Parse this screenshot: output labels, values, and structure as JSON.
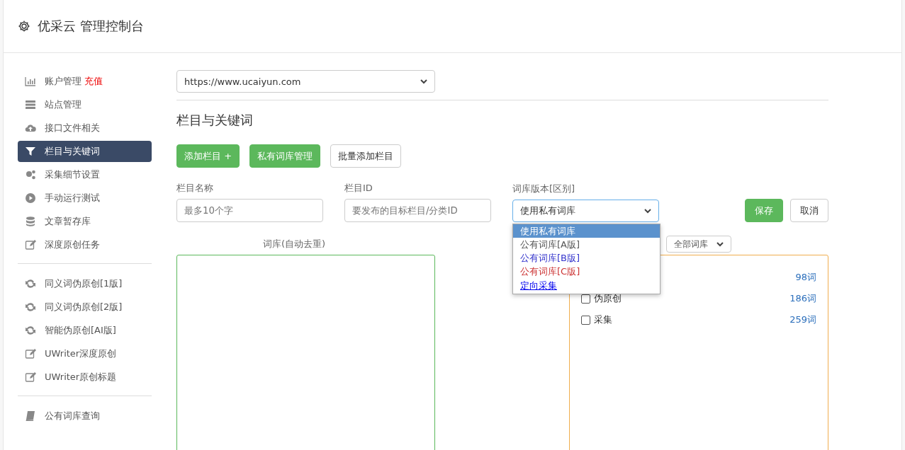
{
  "header": {
    "title": "优采云 管理控制台"
  },
  "sidebar": {
    "groups": [
      {
        "items": [
          {
            "label": "账户管理",
            "badge": "充值",
            "selected": false
          },
          {
            "label": "站点管理",
            "selected": false
          },
          {
            "label": "接口文件相关",
            "selected": false
          },
          {
            "label": "栏目与关键词",
            "selected": true
          },
          {
            "label": "采集细节设置",
            "selected": false
          },
          {
            "label": "手动运行测试",
            "selected": false
          },
          {
            "label": "文章暂存库",
            "selected": false
          },
          {
            "label": "深度原创任务",
            "selected": false
          }
        ]
      },
      {
        "items": [
          {
            "label": "同义词伪原创[1版]",
            "selected": false
          },
          {
            "label": "同义词伪原创[2版]",
            "selected": false
          },
          {
            "label": "智能伪原创[AI版]",
            "selected": false
          },
          {
            "label": "UWriter深度原创",
            "selected": false
          },
          {
            "label": "UWriter原创标题",
            "selected": false
          }
        ]
      },
      {
        "items": [
          {
            "label": "公有词库查询",
            "selected": false
          }
        ]
      }
    ]
  },
  "site_select": {
    "value": "https://www.ucaiyun.com"
  },
  "section_title": "栏目与关键词",
  "toolbar": [
    {
      "label": "添加栏目 +",
      "kind": "primary"
    },
    {
      "label": "私有词库管理",
      "kind": "primary"
    },
    {
      "label": "批量添加栏目",
      "kind": "default"
    }
  ],
  "form": {
    "fields": [
      {
        "label": "栏目名称",
        "placeholder": "最多10个字"
      },
      {
        "label": "栏目ID",
        "placeholder": "要发布的目标栏目/分类ID"
      }
    ],
    "library_label": "词库版本[区别]",
    "library_value": "使用私有词库",
    "library_options": [
      {
        "label": "使用私有词库",
        "selected": true
      },
      {
        "label": "公有词库[A版]",
        "selected": false
      },
      {
        "label": "公有词库[B版]",
        "selected": false,
        "color": "#3333cc"
      },
      {
        "label": "公有词库[C版]",
        "selected": false,
        "color": "#cc3333"
      }
    ],
    "save": "保存",
    "cancel": "取消"
  },
  "keywords_label": "词库(自动去重)",
  "collect_link": "定向采集",
  "filter_select": "全部词库",
  "libraries": [
    {
      "count": "98词"
    },
    {
      "label": "伪原创",
      "count": "186词",
      "checked": false
    },
    {
      "label": "采集",
      "count": "259词",
      "checked": false
    }
  ]
}
